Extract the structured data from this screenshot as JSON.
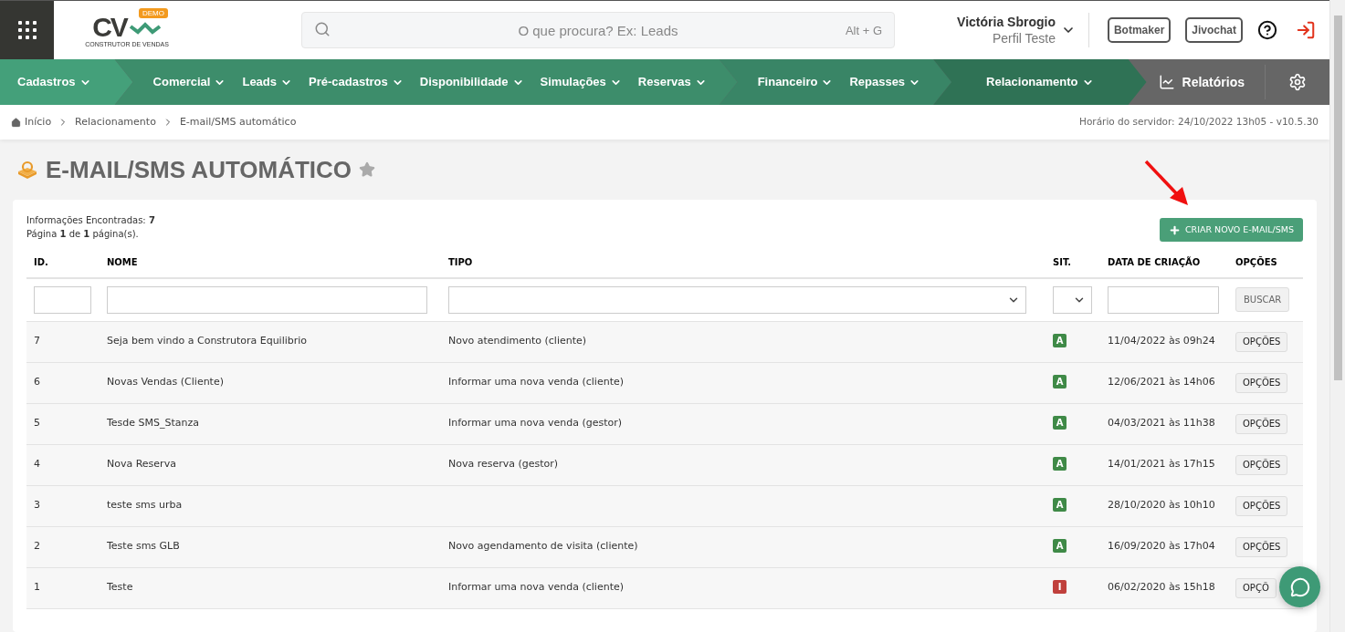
{
  "header": {
    "logo": {
      "letters": "CV",
      "badge": "DEMO",
      "tagline": "CONSTRUTOR DE VENDAS"
    },
    "search": {
      "placeholder": "O que procura? Ex: Leads",
      "shortcut": "Alt + G"
    },
    "user": {
      "name": "Victória Sbrogio",
      "profile": "Perfil Teste"
    },
    "buttons": [
      "Botmaker",
      "Jivochat"
    ]
  },
  "nav": {
    "groups": [
      {
        "items": [
          "Cadastros"
        ]
      },
      {
        "items": [
          "Comercial",
          "Leads",
          "Pré-cadastros",
          "Disponibilidade",
          "Simulações",
          "Reservas"
        ]
      },
      {
        "items": [
          "Financeiro",
          "Repasses"
        ]
      },
      {
        "items": [
          "Relacionamento"
        ]
      }
    ],
    "reports": "Relatórios"
  },
  "breadcrumb": {
    "items": [
      "Início",
      "Relacionamento",
      "E-mail/SMS automático"
    ],
    "server_info": "Horário do servidor: 24/10/2022 13h05 - v10.5.30"
  },
  "page": {
    "title": "E-MAIL/SMS AUTOMÁTICO",
    "found": "Informações Encontradas: **7**",
    "pages": "Página **1** de **1** página(s).",
    "create_button": "CRIAR NOVO E-MAIL/SMS",
    "search_button": "BUSCAR"
  },
  "table": {
    "columns": [
      "ID.",
      "NOME",
      "TIPO",
      "SIT.",
      "DATA DE CRIAÇÃO",
      "OPÇÕES"
    ],
    "rows": [
      {
        "id": "7",
        "name": "Seja bem vindo a Construtora Equilibrio",
        "type": "Novo atendimento (cliente)",
        "status": "A",
        "active": true,
        "date": "11/04/2022 às 09h24",
        "options": "OPÇÕES"
      },
      {
        "id": "6",
        "name": "Novas Vendas (Cliente)",
        "type": "Informar uma nova venda (cliente)",
        "status": "A",
        "active": true,
        "date": "12/06/2021 às 14h06",
        "options": "OPÇÕES"
      },
      {
        "id": "5",
        "name": "Tesde SMS_Stanza",
        "type": "Informar uma nova venda (gestor)",
        "status": "A",
        "active": true,
        "date": "04/03/2021 às 11h38",
        "options": "OPÇÕES"
      },
      {
        "id": "4",
        "name": "Nova Reserva",
        "type": "Nova reserva (gestor)",
        "status": "A",
        "active": true,
        "date": "14/01/2021 às 17h15",
        "options": "OPÇÕES"
      },
      {
        "id": "3",
        "name": "teste sms urba",
        "status": "A",
        "active": true,
        "date": "28/10/2020 às 10h10",
        "options": "OPÇÕES"
      },
      {
        "id": "2",
        "name": "Teste sms GLB",
        "type": "Novo agendamento de visita (cliente)",
        "status": "A",
        "active": true,
        "date": "16/09/2020 às 17h04",
        "options": "OPÇÕES"
      },
      {
        "id": "1",
        "name": "Teste",
        "type": "Informar uma nova venda (cliente)",
        "status": "I",
        "active": false,
        "date": "06/02/2020 às 15h18",
        "options": "OPÇÕ"
      }
    ]
  }
}
